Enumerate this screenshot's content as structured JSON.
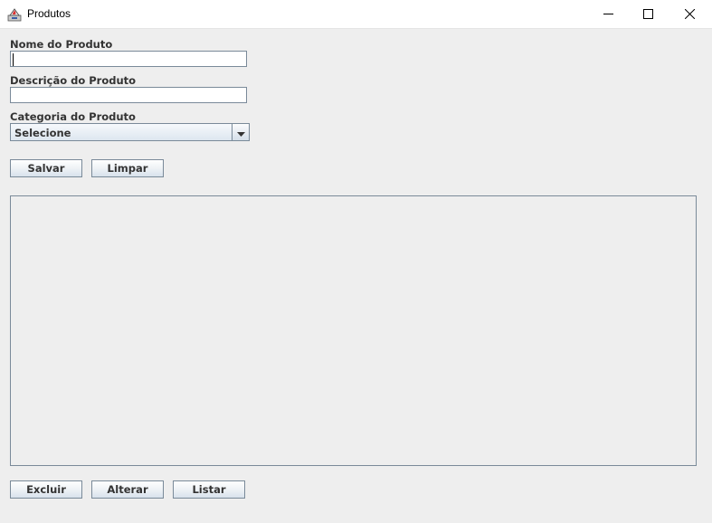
{
  "window": {
    "title": "Produtos",
    "icon": "java-app-icon",
    "controls": [
      "minimize-icon",
      "maximize-icon",
      "close-icon"
    ]
  },
  "form": {
    "nome": {
      "label": "Nome do Produto",
      "value": "",
      "placeholder": ""
    },
    "descricao": {
      "label": "Descrição do Produto",
      "value": "",
      "placeholder": ""
    },
    "categoria": {
      "label": "Categoria do Produto",
      "selected": "Selecione"
    }
  },
  "buttons": {
    "salvar": "Salvar",
    "limpar": "Limpar",
    "excluir": "Excluir",
    "alterar": "Alterar",
    "listar": "Listar"
  },
  "colors": {
    "background": "#eeeeee",
    "border": "#7a8a99",
    "text": "#333333"
  }
}
